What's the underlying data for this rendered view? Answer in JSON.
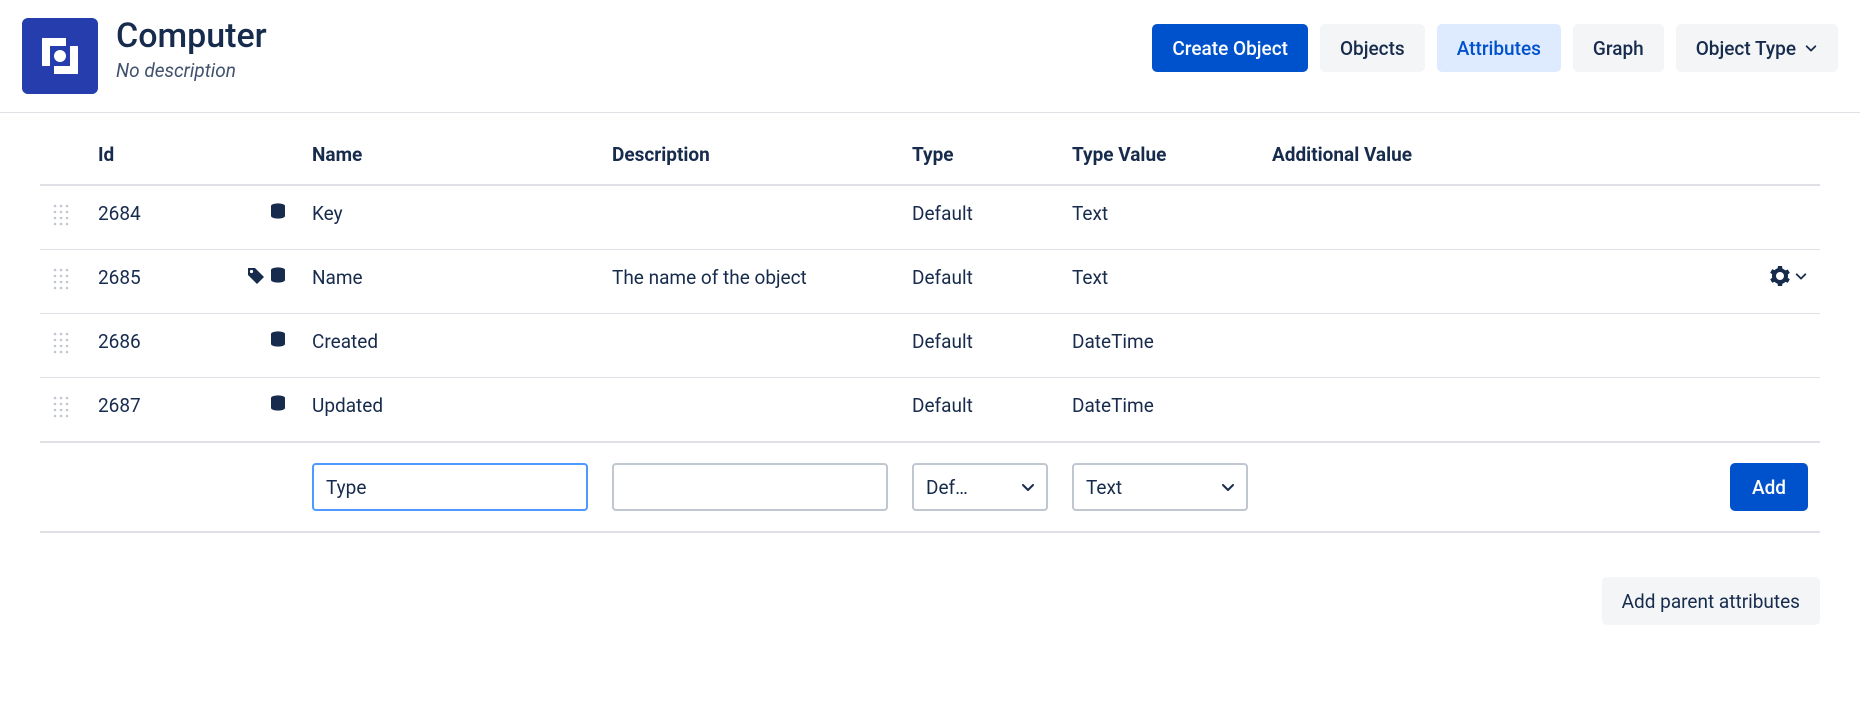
{
  "header": {
    "title": "Computer",
    "subtitle": "No description",
    "create_label": "Create Object",
    "tabs": {
      "objects": "Objects",
      "attributes": "Attributes",
      "graph": "Graph"
    },
    "object_type_label": "Object Type"
  },
  "table": {
    "columns": {
      "id": "Id",
      "name": "Name",
      "description": "Description",
      "type": "Type",
      "type_value": "Type Value",
      "additional_value": "Additional Value"
    },
    "rows": [
      {
        "id": "2684",
        "name": "Key",
        "description": "",
        "type": "Default",
        "type_value": "Text",
        "has_tag": false,
        "show_actions": false
      },
      {
        "id": "2685",
        "name": "Name",
        "description": "The name of the object",
        "type": "Default",
        "type_value": "Text",
        "has_tag": true,
        "show_actions": true
      },
      {
        "id": "2686",
        "name": "Created",
        "description": "",
        "type": "Default",
        "type_value": "DateTime",
        "has_tag": false,
        "show_actions": false
      },
      {
        "id": "2687",
        "name": "Updated",
        "description": "",
        "type": "Default",
        "type_value": "DateTime",
        "has_tag": false,
        "show_actions": false
      }
    ],
    "add_row": {
      "name_value": "Type",
      "description_value": "",
      "type_selected": "Def…",
      "type_value_selected": "Text",
      "add_label": "Add"
    }
  },
  "footer": {
    "add_parent_label": "Add parent attributes"
  }
}
